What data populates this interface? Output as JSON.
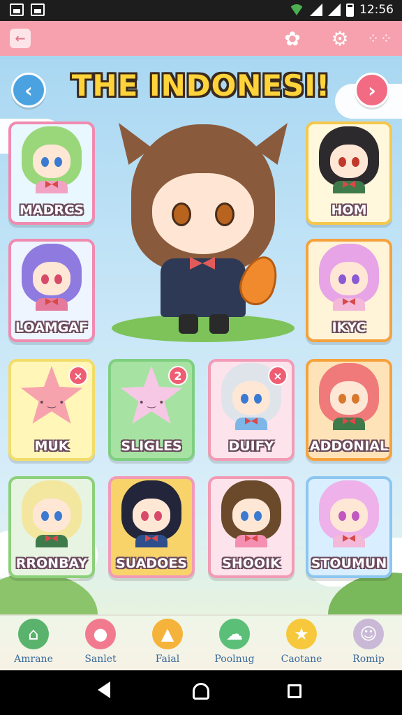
{
  "status_bar": {
    "time": "12:56",
    "icons": [
      "gallery-icon",
      "image-icon",
      "wifi-icon",
      "signal-icon",
      "signal-icon",
      "battery-icon"
    ]
  },
  "app_bar": {
    "icons": [
      "back-icon",
      "flower-icon",
      "gear-icon",
      "grid-icon"
    ]
  },
  "header": {
    "title": "THE INDONESI!",
    "prev_icon": "chevron-left-icon",
    "next_icon": "chevron-right-icon"
  },
  "side_cards": [
    {
      "label": "MADRCS",
      "hair": "#9ad77a",
      "bg": "#e9f7ff",
      "border": "#f08bb0",
      "eye": "#3b7ad1",
      "body": "#f2a2c3"
    },
    {
      "label": "LOAMGAF",
      "hair": "#8f7be0",
      "bg": "#eef5ff",
      "border": "#f08bb0",
      "eye": "#d84a6a",
      "body": "#e57a9c"
    },
    {
      "label": "HOM",
      "hair": "#2d2a2e",
      "bg": "#fff8dc",
      "border": "#f5c84c",
      "eye": "#c0392b",
      "body": "#3f7a4a"
    },
    {
      "label": "IKYC",
      "hair": "#e7a4e6",
      "bg": "#fff3d8",
      "border": "#f5a23c",
      "eye": "#8a5ad3",
      "body": "#f4b8d8"
    }
  ],
  "grid_cards": [
    {
      "label": "MUK",
      "type": "star",
      "star": "#f7a3ad",
      "bg": "#fff6b8",
      "border": "#f2dc6a",
      "badge": "×"
    },
    {
      "label": "SLIGLES",
      "type": "star",
      "star": "#f7c8e6",
      "bg": "#a6e3a3",
      "border": "#7fcf81",
      "badge": "2"
    },
    {
      "label": "DUIFY",
      "type": "chibi",
      "hair": "#dfe4ea",
      "bg": "#fde3ec",
      "border": "#f29bb5",
      "eye": "#3b7ad1",
      "body": "#7fb6e8",
      "badge": "×"
    },
    {
      "label": "ADDONIAL",
      "type": "chibi",
      "hair": "#f07a7a",
      "bg": "#ffe3b8",
      "border": "#f5a23c",
      "eye": "#d8782c",
      "body": "#3f7a4a",
      "badge": ""
    },
    {
      "label": "RRONBAY",
      "type": "chibi",
      "hair": "#f3e7a0",
      "bg": "#e7f4e1",
      "border": "#8cd07a",
      "eye": "#3b7ad1",
      "body": "#3f7a4a",
      "badge": ""
    },
    {
      "label": "SUADOES",
      "type": "chibi",
      "hair": "#23253a",
      "bg": "#f7d36a",
      "border": "#f29bb5",
      "eye": "#d84a6a",
      "body": "#2e4e8c",
      "badge": ""
    },
    {
      "label": "SHOOIK",
      "type": "chibi",
      "hair": "#6b4a2c",
      "bg": "#fde3ec",
      "border": "#f29bb5",
      "eye": "#3b7ad1",
      "body": "#f48fb1",
      "badge": ""
    },
    {
      "label": "STOUMUN",
      "type": "chibi",
      "hair": "#eeb1ea",
      "bg": "#d9efff",
      "border": "#8cc6f0",
      "eye": "#c058c0",
      "body": "#f4b8d8",
      "badge": ""
    }
  ],
  "bottom_nav": [
    {
      "label": "Amrane",
      "icon": "home-icon",
      "color": "#5ab36c",
      "glyph": "⌂"
    },
    {
      "label": "Sanlet",
      "icon": "peach-icon",
      "color": "#f27a8f",
      "glyph": "●"
    },
    {
      "label": "Faial",
      "icon": "cat-icon",
      "color": "#f5b33c",
      "glyph": "▲"
    },
    {
      "label": "Poolnug",
      "icon": "cloud-icon",
      "color": "#5bbf78",
      "glyph": "☁"
    },
    {
      "label": "Caotane",
      "icon": "star-icon",
      "color": "#f7c83c",
      "glyph": "★"
    },
    {
      "label": "Romip",
      "icon": "mascot-icon",
      "color": "#c9b9d6",
      "glyph": "☺"
    }
  ]
}
